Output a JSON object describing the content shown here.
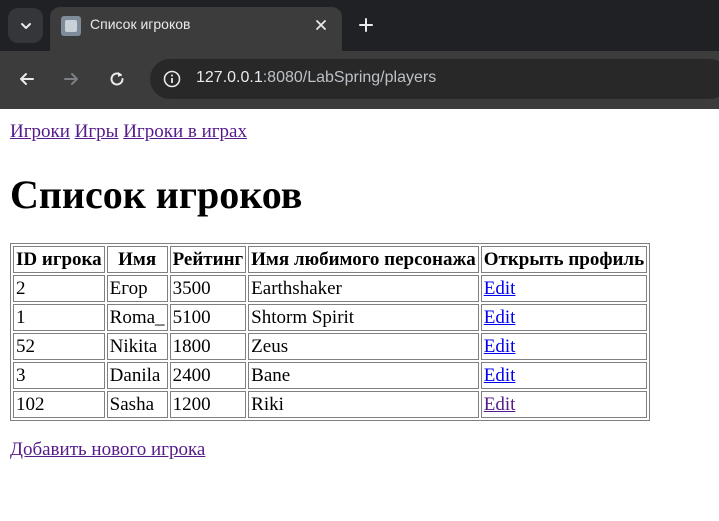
{
  "browser": {
    "tab_title": "Список игроков",
    "url_host": "127.0.0.1",
    "url_rest": ":8080/LabSpring/players"
  },
  "nav": {
    "players": "Игроки",
    "games": "Игры",
    "players_in_games": "Игроки в играх"
  },
  "page_title": "Список игроков",
  "table": {
    "headers": [
      "ID игрока",
      "Имя",
      "Рейтинг",
      "Имя любимого персонажа",
      "Открыть профиль"
    ],
    "rows": [
      {
        "id": "2",
        "name": "Егор",
        "rating": "3500",
        "hero": "Earthshaker",
        "action": "Edit"
      },
      {
        "id": "1",
        "name": "Roma_",
        "rating": "5100",
        "hero": "Shtorm Spirit",
        "action": "Edit"
      },
      {
        "id": "52",
        "name": "Nikita",
        "rating": "1800",
        "hero": "Zeus",
        "action": "Edit"
      },
      {
        "id": "3",
        "name": "Danila",
        "rating": "2400",
        "hero": "Bane",
        "action": "Edit"
      },
      {
        "id": "102",
        "name": "Sasha",
        "rating": "1200",
        "hero": "Riki",
        "action": "Edit"
      }
    ]
  },
  "add_link": "Добавить нового игрока",
  "colors": {
    "link_visited": "#551a8b",
    "link_unvisited": "#0000ee",
    "chrome_bg": "#3c3c3c",
    "tabstrip_bg": "#202124"
  }
}
